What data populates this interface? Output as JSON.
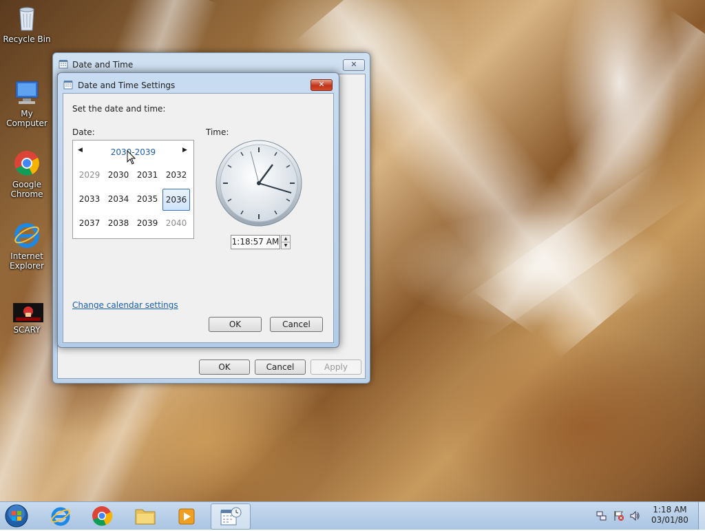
{
  "desktop_icons": [
    {
      "label": "Recycle Bin",
      "icon": "recycle-bin-icon"
    },
    {
      "label": "My Computer",
      "icon": "computer-icon"
    },
    {
      "label": "Google Chrome",
      "icon": "chrome-icon"
    },
    {
      "label": "Internet Explorer",
      "icon": "internet-explorer-icon"
    },
    {
      "label": "SCARY",
      "icon": "scary-game-icon"
    }
  ],
  "outer_window": {
    "title": "Date and Time",
    "buttons": {
      "ok": "OK",
      "cancel": "Cancel",
      "apply": "Apply"
    }
  },
  "settings_dialog": {
    "title": "Date and Time Settings",
    "instruction": "Set the date and time:",
    "date_label": "Date:",
    "time_label": "Time:",
    "calendar": {
      "header": "2030-2039",
      "years": [
        {
          "label": "2029",
          "state": "dim"
        },
        {
          "label": "2030",
          "state": "normal"
        },
        {
          "label": "2031",
          "state": "normal"
        },
        {
          "label": "2032",
          "state": "normal"
        },
        {
          "label": "2033",
          "state": "normal"
        },
        {
          "label": "2034",
          "state": "normal"
        },
        {
          "label": "2035",
          "state": "normal"
        },
        {
          "label": "2036",
          "state": "selected"
        },
        {
          "label": "2037",
          "state": "normal"
        },
        {
          "label": "2038",
          "state": "normal"
        },
        {
          "label": "2039",
          "state": "normal"
        },
        {
          "label": "2040",
          "state": "dim"
        }
      ]
    },
    "time_value": "1:18:57 AM",
    "change_calendar_link": "Change calendar settings",
    "ok": "OK",
    "cancel": "Cancel"
  },
  "taskbar": {
    "items": [
      "start-orb-icon",
      "internet-explorer-icon",
      "chrome-icon",
      "folder-icon",
      "media-player-icon",
      "date-time-control-panel-icon"
    ],
    "clock_time": "1:18 AM",
    "clock_date": "03/01/80"
  }
}
